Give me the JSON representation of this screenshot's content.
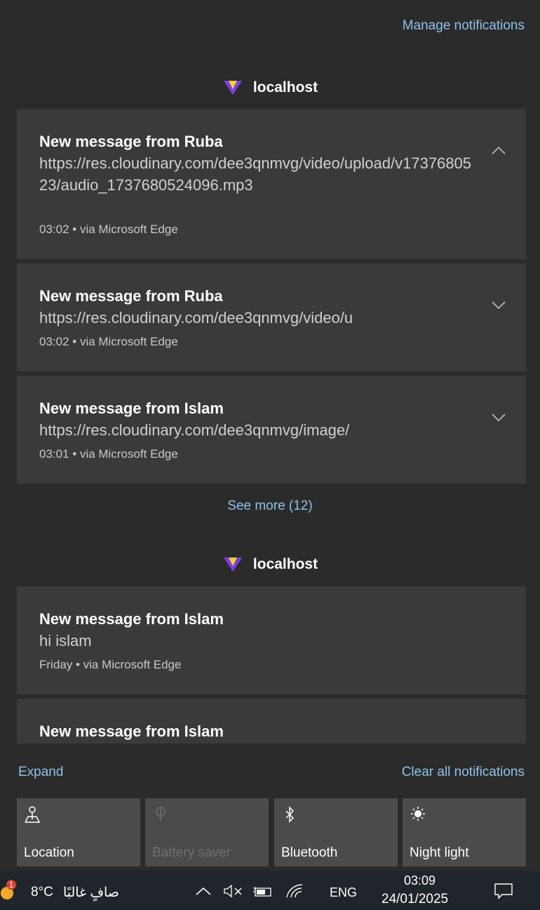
{
  "header": {
    "manage_label": "Manage notifications"
  },
  "groups": [
    {
      "app_name": "localhost",
      "notifications": [
        {
          "title": "New message from Ruba",
          "body": "https://res.cloudinary.com/dee3qnmvg/video/upload/v1737680523/audio_1737680524096.mp3",
          "meta": "03:02 • via Microsoft Edge",
          "expanded": true
        },
        {
          "title": "New message from Ruba",
          "body": "https://res.cloudinary.com/dee3qnmvg/video/u",
          "meta": "03:02 • via Microsoft Edge",
          "expanded": false
        },
        {
          "title": "New message from Islam",
          "body": "https://res.cloudinary.com/dee3qnmvg/image/",
          "meta": "03:01 • via Microsoft Edge",
          "expanded": false
        }
      ],
      "see_more_label": "See more (12)"
    },
    {
      "app_name": "localhost",
      "notifications": [
        {
          "title": "New message from Islam",
          "body": "hi islam",
          "meta": "Friday • via Microsoft Edge"
        },
        {
          "title": "New message from Islam"
        }
      ]
    }
  ],
  "actions": {
    "expand_label": "Expand",
    "clear_label": "Clear all notifications"
  },
  "quick_actions": [
    {
      "label": "Location",
      "icon": "location-icon",
      "enabled": true
    },
    {
      "label": "Battery saver",
      "icon": "battery-saver-icon",
      "enabled": false
    },
    {
      "label": "Bluetooth",
      "icon": "bluetooth-icon",
      "enabled": true
    },
    {
      "label": "Night light",
      "icon": "night-light-icon",
      "enabled": true
    }
  ],
  "taskbar": {
    "weather_badge": "1",
    "weather_temp": "8°C",
    "weather_desc": "صافٍ غالبًا",
    "language": "ENG",
    "time": "03:09",
    "date": "24/01/2025"
  },
  "colors": {
    "panel_bg": "#2b2b2b",
    "card_bg": "#3a3a3a",
    "tile_bg": "#4b4b4b",
    "link": "#8ec2ea",
    "taskbar_bg": "#20242b"
  }
}
